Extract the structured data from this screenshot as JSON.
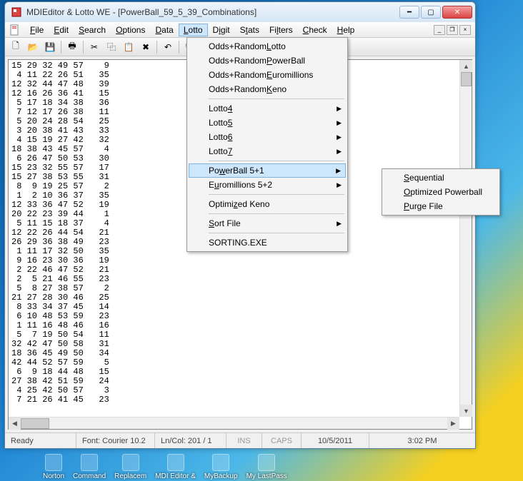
{
  "window": {
    "title": "MDIEditor & Lotto WE - [PowerBall_59_5_39_Combinations]"
  },
  "menubar": [
    "File",
    "Edit",
    "Search",
    "Options",
    "Data",
    "Lotto",
    "Digit",
    "Stats",
    "Filters",
    "Check",
    "Help"
  ],
  "menubar_active_index": 5,
  "lotto_menu": {
    "group1": [
      "Odds+Random Lotto",
      "Odds+Random PowerBall",
      "Odds+Random Euromillions",
      "Odds+Random Keno"
    ],
    "group2": [
      "Lotto 4",
      "Lotto 5",
      "Lotto 6",
      "Lotto 7"
    ],
    "group3": [
      "PowerBall 5+1",
      "Euromillions 5+2"
    ],
    "group3_hover_index": 0,
    "group4": [
      "Optimized Keno"
    ],
    "group5": [
      "Sort File"
    ],
    "group6": [
      "SORTING.EXE"
    ]
  },
  "submenu": [
    "Sequential",
    "Optimized Powerball",
    "Purge File"
  ],
  "editor_lines": [
    "15 29 32 49 57    9",
    " 4 11 22 26 51   35",
    "12 32 44 47 48   39",
    "12 16 26 36 41   15",
    " 5 17 18 34 38   36",
    " 7 12 17 26 38   11",
    " 5 20 24 28 54   25",
    " 3 20 38 41 43   33",
    " 4 15 19 27 42   32",
    "18 38 43 45 57    4",
    " 6 26 47 50 53   30",
    "15 23 32 55 57   17",
    "15 27 38 53 55   31",
    " 8  9 19 25 57    2",
    " 1  2 10 36 37   35",
    "12 33 36 47 52   19",
    "20 22 23 39 44    1",
    " 5 11 15 18 37    4",
    "12 22 26 44 54   21",
    "26 29 36 38 49   23",
    " 1 11 17 32 50   35",
    " 9 16 23 30 36   19",
    " 2 22 46 47 52   21",
    " 2  5 21 46 55   23",
    " 5  8 27 38 57    2",
    "21 27 28 30 46   25",
    " 8 33 34 37 45   14",
    " 6 10 48 53 59   23",
    " 1 11 16 48 46   16",
    " 5  7 19 50 54   11",
    "32 42 47 50 58   31",
    "18 36 45 49 50   34",
    "42 44 52 57 59    5",
    " 6  9 18 44 48   15",
    "27 38 42 51 59   24",
    " 4 25 42 50 57    3",
    " 7 21 26 41 45   23"
  ],
  "status": {
    "ready": "Ready",
    "font": "Font: Courier 10.2",
    "lncol": "Ln/Col: 201 / 1",
    "ins": "INS",
    "caps": "CAPS",
    "date": "10/5/2011",
    "time": "3:02 PM"
  },
  "taskbar": [
    "Norton",
    "Command",
    "Replacem",
    "MDI Editor &",
    "MyBackup",
    "My LastPass"
  ],
  "toolbar_icons": [
    "new-icon",
    "open-icon",
    "save-icon",
    "print-icon",
    "cut-icon",
    "copy-icon",
    "paste-icon",
    "delete-icon",
    "undo-icon",
    "find-icon",
    "replace-icon",
    "bracket-a-icon"
  ]
}
